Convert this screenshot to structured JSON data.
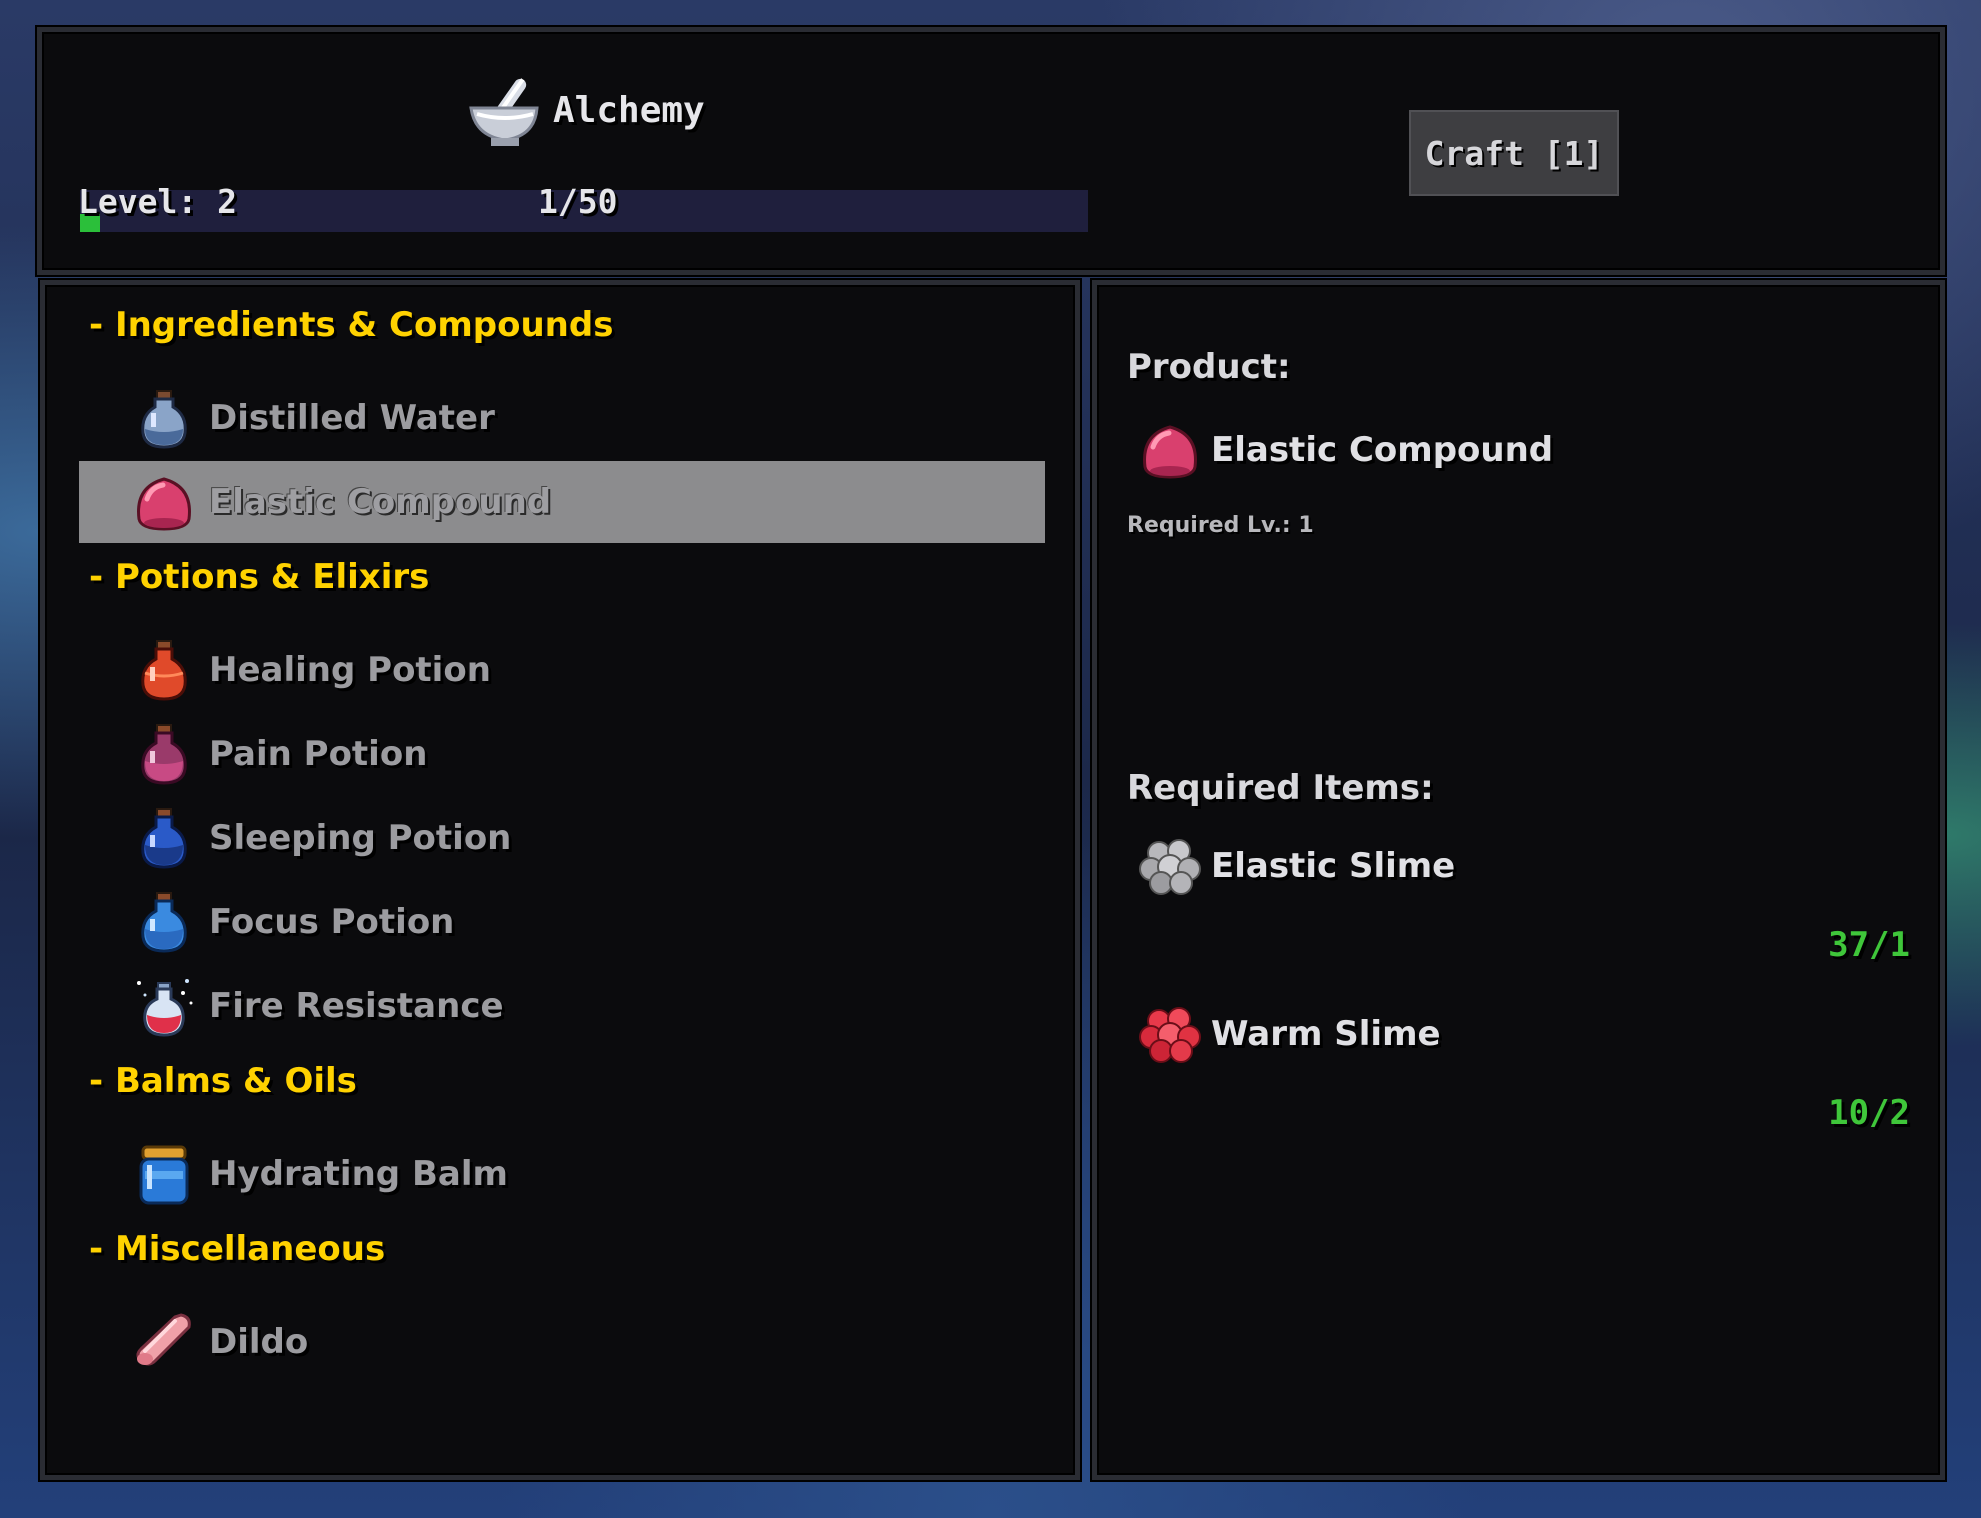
{
  "header": {
    "title": "Alchemy",
    "title_icon": "mortar-pestle-icon",
    "level_label": "Level: 2",
    "progress_label": "1/50",
    "progress_fraction": 0.02,
    "craft_label": "Craft [1]"
  },
  "recipes": {
    "categories": [
      {
        "label": "- Ingredients & Compounds",
        "items": [
          {
            "label": "Distilled Water",
            "icon": "water-flask-icon"
          },
          {
            "label": "Elastic Compound",
            "icon": "pink-gel-icon",
            "selected": true
          }
        ]
      },
      {
        "label": "- Potions & Elixirs",
        "items": [
          {
            "label": "Healing Potion",
            "icon": "red-potion-icon"
          },
          {
            "label": "Pain Potion",
            "icon": "purple-potion-icon"
          },
          {
            "label": "Sleeping Potion",
            "icon": "blue-potion-icon"
          },
          {
            "label": "Focus Potion",
            "icon": "light-blue-potion-icon"
          },
          {
            "label": "Fire Resistance",
            "icon": "sparkling-red-potion-icon"
          }
        ]
      },
      {
        "label": "- Balms & Oils",
        "items": [
          {
            "label": "Hydrating Balm",
            "icon": "balm-jar-icon"
          }
        ]
      },
      {
        "label": "- Miscellaneous",
        "items": [
          {
            "label": "Dildo",
            "icon": "pink-rod-icon"
          }
        ]
      }
    ]
  },
  "details": {
    "product_heading": "Product:",
    "product_name": "Elastic Compound",
    "product_icon": "pink-gel-icon",
    "required_level": "Required Lv.: 1",
    "required_heading": "Required Items:",
    "requirements": [
      {
        "label": "Elastic Slime",
        "icon": "grey-slime-icon",
        "count": "37/1"
      },
      {
        "label": "Warm Slime",
        "icon": "red-slime-icon",
        "count": "10/2"
      }
    ]
  },
  "colors": {
    "category": "#ffd200",
    "count_ok": "#3fc63a",
    "progress_fill": "#2bbf3a",
    "progress_track": "#1f1f3d"
  }
}
